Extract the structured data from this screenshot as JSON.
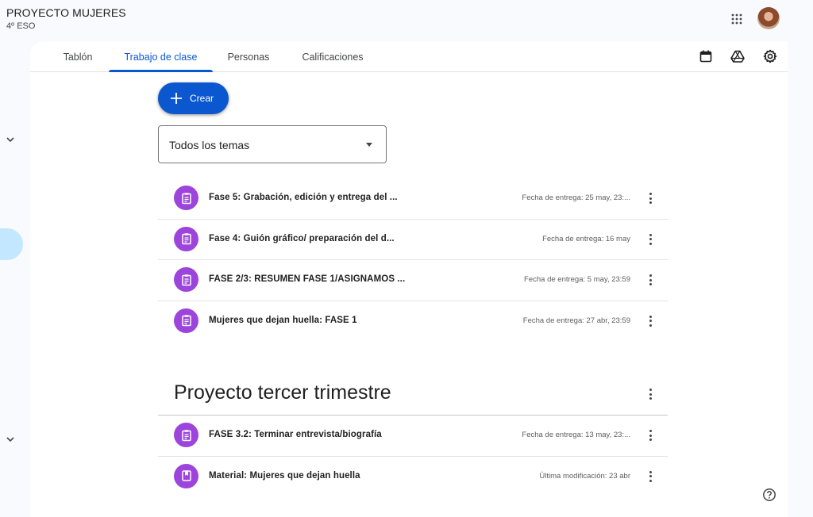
{
  "header": {
    "class_name": "PROYECTO MUJERES",
    "class_section": "4º ESO",
    "apps_icon": "apps-grid-icon",
    "avatar_icon": "user-avatar"
  },
  "tabs": [
    {
      "label": "Tablón",
      "active": false
    },
    {
      "label": "Trabajo de clase",
      "active": true
    },
    {
      "label": "Personas",
      "active": false
    },
    {
      "label": "Calificaciones",
      "active": false
    }
  ],
  "toolbar": {
    "icons": [
      "calendar-icon",
      "drive-icon",
      "settings-icon"
    ]
  },
  "create_button": {
    "label": "Crear",
    "icon": "plus-icon"
  },
  "topic_filter": {
    "selected": "Todos los temas"
  },
  "assignments": [
    {
      "title": "Fase 5: Grabación, edición y entrega del ...",
      "meta": "Fecha de entrega: 25 may, 23:...",
      "icon": "assignment-icon"
    },
    {
      "title": "Fase 4: Guión gráfico/ preparación del d...",
      "meta": "Fecha de entrega: 16 may",
      "icon": "assignment-icon"
    },
    {
      "title": "FASE 2/3: RESUMEN FASE 1/ASIGNAMOS ...",
      "meta": "Fecha de entrega: 5 may, 23:59",
      "icon": "assignment-icon"
    },
    {
      "title": "Mujeres que dejan huella: FASE 1",
      "meta": "Fecha de entrega: 27 abr, 23:59",
      "icon": "assignment-icon"
    }
  ],
  "topic_section": {
    "title": "Proyecto tercer trimestre",
    "items": [
      {
        "title": "FASE 3.2: Terminar entrevista/biografía",
        "meta": "Fecha de entrega: 13 may, 23:...",
        "icon": "assignment-icon"
      },
      {
        "title": "Material: Mujeres que dejan huella",
        "meta": "Última modificación: 23 abr",
        "icon": "material-icon"
      }
    ]
  },
  "colors": {
    "accent": "#0b57d0",
    "item_icon_bg": "#9c44dc",
    "background": "#f8fafd",
    "rail_highlight": "#c2e7ff"
  }
}
